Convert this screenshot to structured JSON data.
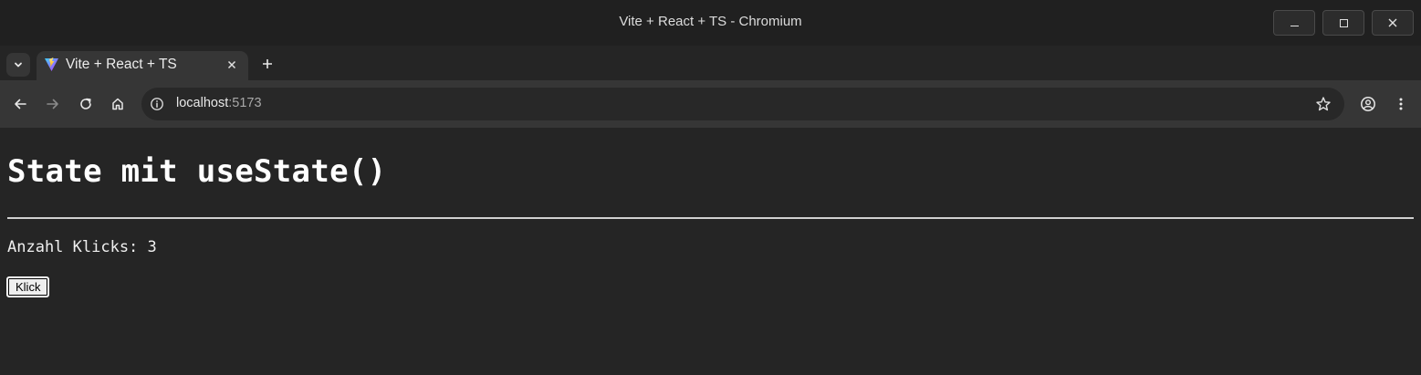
{
  "window": {
    "title": "Vite + React + TS - Chromium"
  },
  "tabs": [
    {
      "title": "Vite + React + TS",
      "active": true
    }
  ],
  "toolbar": {
    "url_host": "localhost",
    "url_port": ":5173"
  },
  "page": {
    "heading": "State mit useState()",
    "click_count_text": "Anzahl Klicks: 3",
    "button_label": "Klick"
  },
  "colors": {
    "window_bg": "#202020",
    "toolbar_bg": "#363636",
    "page_bg": "#252525",
    "text": "#ffffff"
  }
}
